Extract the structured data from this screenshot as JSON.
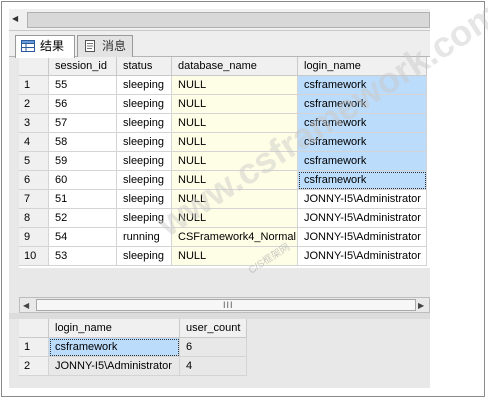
{
  "tabs": [
    {
      "label": "结果"
    },
    {
      "label": "消息"
    }
  ],
  "results": {
    "columns": [
      "session_id",
      "status",
      "database_name",
      "login_name"
    ],
    "rows": [
      {
        "num": "1",
        "session_id": "55",
        "status": "sleeping",
        "database_name": "NULL",
        "login_name": "csframework"
      },
      {
        "num": "2",
        "session_id": "56",
        "status": "sleeping",
        "database_name": "NULL",
        "login_name": "csframework"
      },
      {
        "num": "3",
        "session_id": "57",
        "status": "sleeping",
        "database_name": "NULL",
        "login_name": "csframework"
      },
      {
        "num": "4",
        "session_id": "58",
        "status": "sleeping",
        "database_name": "NULL",
        "login_name": "csframework"
      },
      {
        "num": "5",
        "session_id": "59",
        "status": "sleeping",
        "database_name": "NULL",
        "login_name": "csframework"
      },
      {
        "num": "6",
        "session_id": "60",
        "status": "sleeping",
        "database_name": "NULL",
        "login_name": "csframework"
      },
      {
        "num": "7",
        "session_id": "51",
        "status": "sleeping",
        "database_name": "NULL",
        "login_name": "JONNY-I5\\Administrator"
      },
      {
        "num": "8",
        "session_id": "52",
        "status": "sleeping",
        "database_name": "NULL",
        "login_name": "JONNY-I5\\Administrator"
      },
      {
        "num": "9",
        "session_id": "54",
        "status": "running",
        "database_name": "CSFramework4_Normal",
        "login_name": "JONNY-I5\\Administrator"
      },
      {
        "num": "10",
        "session_id": "53",
        "status": "sleeping",
        "database_name": "NULL",
        "login_name": "JONNY-I5\\Administrator"
      }
    ]
  },
  "summary": {
    "columns": [
      "login_name",
      "user_count"
    ],
    "rows": [
      {
        "num": "1",
        "login_name": "csframework",
        "user_count": "6"
      },
      {
        "num": "2",
        "login_name": "JONNY-I5\\Administrator",
        "user_count": "4"
      }
    ]
  },
  "scrollbar": {
    "grip": "III"
  },
  "watermark": {
    "text": "www.csframework.com",
    "subtext": "C/S框架网"
  },
  "colors": {
    "selection": "#bcdcfb",
    "database_column": "#fefee6"
  }
}
